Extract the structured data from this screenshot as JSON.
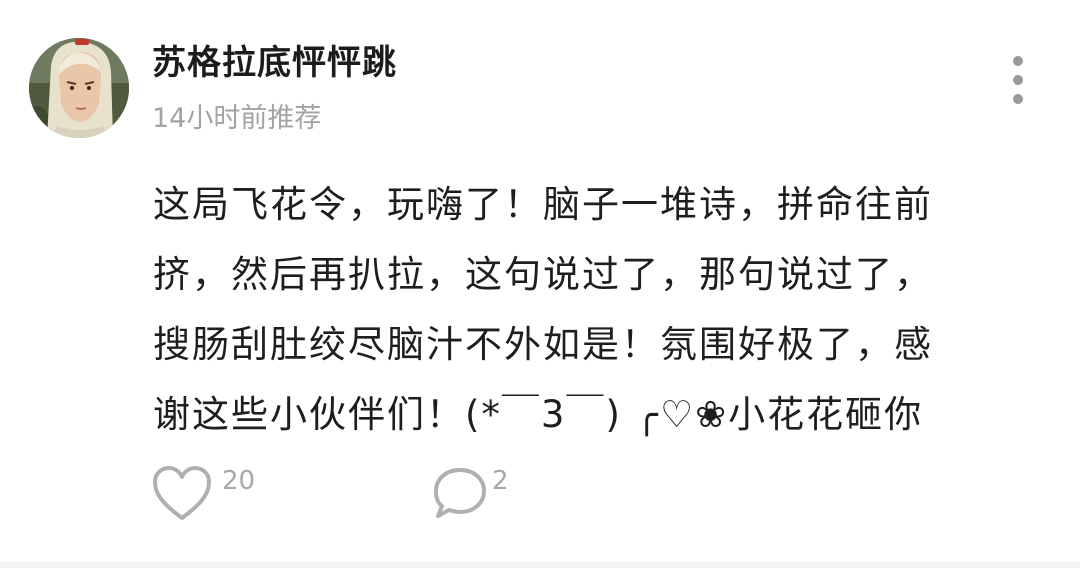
{
  "post": {
    "author": "苏格拉底怦怦跳",
    "time": "14小时前推荐",
    "lines": [
      "这局飞花令，玩嗨了！脑子一堆诗，拼命往前",
      "挤，然后再扒拉，这句说过了，那句说过了，",
      "搜肠刮肚绞尽脑汁不外如是！氛围好极了，感",
      "谢这些小伙伴们！(*￣3￣) ╭♡❀小花花砸你"
    ]
  },
  "actions": {
    "likes": "20",
    "comments": "2"
  },
  "icons": {
    "avatar": "avatar-portrait",
    "more": "more-vertical-icon",
    "like": "heart-outline-icon",
    "comment": "chat-bubble-icon"
  },
  "colors": {
    "text": "#1e1e1e",
    "meta": "#a3a3a3",
    "icon": "#b0b0b0",
    "background": "#ffffff"
  }
}
